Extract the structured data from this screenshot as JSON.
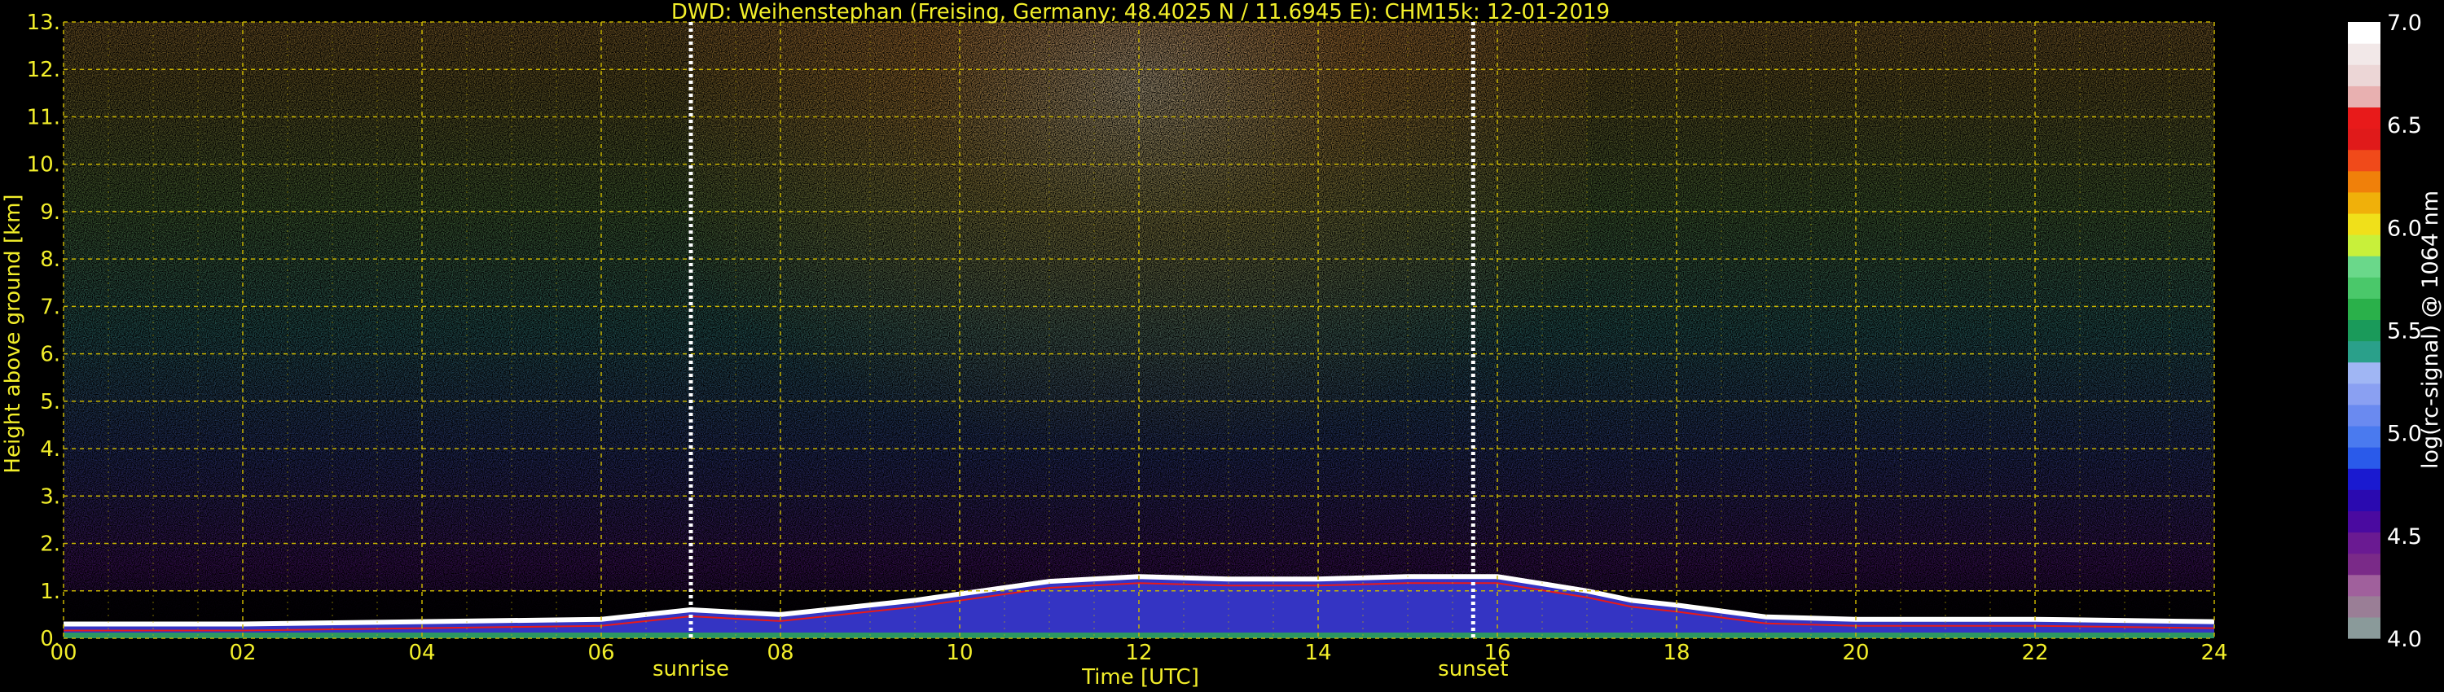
{
  "colors": {
    "background": "#000000",
    "text_yellow": "#f2ee2a",
    "grid_yellow": "#c8b400",
    "marker_white": "#ffffff"
  },
  "chart_data": {
    "type": "heatmap",
    "title": "DWD: Weihenstephan (Freising, Germany; 48.4025 N / 11.6945 E):    CHM15k: 12-01-2019",
    "xlabel": "Time [UTC]",
    "ylabel": "Height above ground [km]",
    "xlim": [
      0,
      24
    ],
    "ylim": [
      0,
      13
    ],
    "x_ticks": [
      "00",
      "02",
      "04",
      "06",
      "08",
      "10",
      "12",
      "14",
      "16",
      "18",
      "20",
      "22",
      "24"
    ],
    "x_tick_values": [
      0,
      2,
      4,
      6,
      8,
      10,
      12,
      14,
      16,
      18,
      20,
      22,
      24
    ],
    "y_ticks": [
      "0.",
      "1.",
      "2.",
      "3.",
      "4.",
      "5.",
      "6.",
      "7.",
      "8.",
      "9.",
      "10.",
      "11.",
      "12.",
      "13."
    ],
    "y_tick_values": [
      0,
      1,
      2,
      3,
      4,
      5,
      6,
      7,
      8,
      9,
      10,
      11,
      12,
      13
    ],
    "grid": true,
    "markers": [
      {
        "label": "sunrise",
        "time": 7.0
      },
      {
        "label": "sunset",
        "time": 15.73
      }
    ],
    "colorbar": {
      "label": "log(rc-signal) @ 1064 nm",
      "range": [
        4.0,
        7.0
      ],
      "ticks": [
        "4.0",
        "4.5",
        "5.0",
        "5.5",
        "6.0",
        "6.5",
        "7.0"
      ],
      "tick_values": [
        4.0,
        4.5,
        5.0,
        5.5,
        6.0,
        6.5,
        7.0
      ],
      "colors": [
        "#8a9a9a",
        "#9a7e96",
        "#a0609c",
        "#7a2a88",
        "#6a1a92",
        "#4a0aa0",
        "#2a0ab0",
        "#1a1ad0",
        "#2a5aea",
        "#4a7aef",
        "#6a8af0",
        "#8aa0f2",
        "#a0b6f4",
        "#2aa08a",
        "#1a9a5a",
        "#2ab04a",
        "#4ac86a",
        "#6ad88a",
        "#c8f03a",
        "#f0e01a",
        "#f0b00a",
        "#f0800a",
        "#f04a1a",
        "#e01a1a",
        "#e81a1a",
        "#e8b0b0",
        "#ecd6d6",
        "#f2e8e8",
        "#ffffff"
      ]
    },
    "boundary_layer_top_km": {
      "time": [
        0,
        2,
        4,
        6,
        7,
        8,
        9.5,
        11,
        12,
        13,
        14,
        15,
        16,
        17,
        17.5,
        18,
        19,
        20,
        22,
        24
      ],
      "height": [
        0.3,
        0.3,
        0.35,
        0.4,
        0.6,
        0.5,
        0.8,
        1.2,
        1.3,
        1.25,
        1.25,
        1.3,
        1.3,
        1.0,
        0.8,
        0.7,
        0.45,
        0.4,
        0.4,
        0.35
      ]
    }
  }
}
